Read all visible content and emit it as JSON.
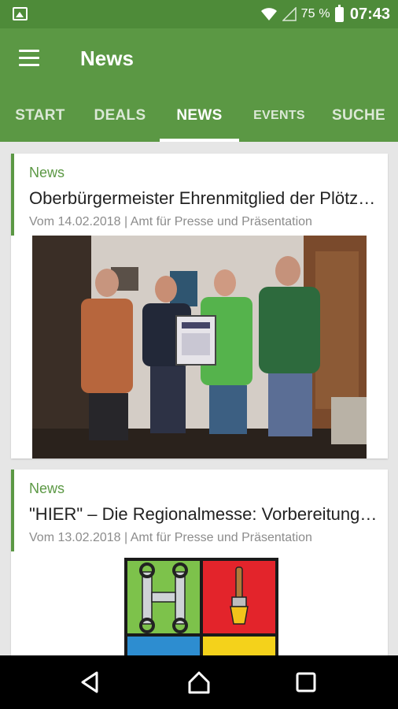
{
  "status_bar": {
    "battery_percent": "75 %",
    "time": "07:43",
    "icons": [
      "image-notification-icon",
      "wifi-icon",
      "signal-icon",
      "battery-icon"
    ]
  },
  "toolbar": {
    "title": "News",
    "menu_icon": "hamburger-menu-icon"
  },
  "tabs": [
    {
      "label": "START",
      "active": false
    },
    {
      "label": "DEALS",
      "active": false
    },
    {
      "label": "NEWS",
      "active": true
    },
    {
      "label": "EVENTS",
      "active": false
    },
    {
      "label": "SUCHE",
      "active": false
    }
  ],
  "news": [
    {
      "category": "News",
      "title": "Oberbürgermeister Ehrenmitglied der Plötzky…",
      "meta": "Vom 14.02.2018 | Amt für Presse und Präsentation",
      "image": "group-photo-with-certificate"
    },
    {
      "category": "News",
      "title": "\"HIER\" – Die Regionalmesse: Vorbereitungen l…",
      "meta": "Vom 13.02.2018 | Amt für Presse und Präsentation",
      "image": "regionalmesse-logo"
    }
  ],
  "navbar": {
    "icons": [
      "back-icon",
      "home-icon",
      "recents-icon"
    ]
  },
  "colors": {
    "status_bar": "#4e8b39",
    "primary": "#5b9844",
    "background": "#e6e6e6"
  }
}
